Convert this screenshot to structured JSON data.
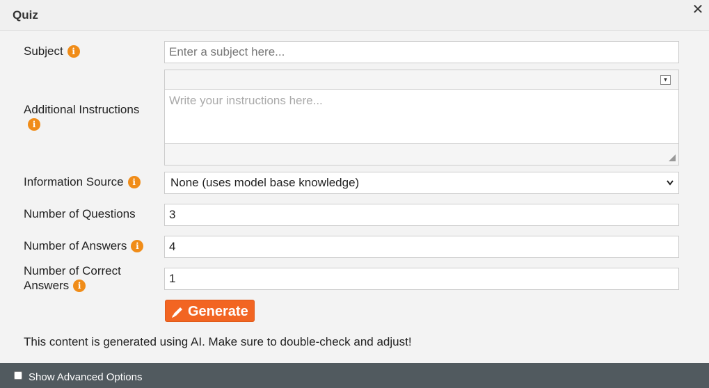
{
  "dialog": {
    "title": "Quiz",
    "close_glyph": "✕"
  },
  "form": {
    "subject": {
      "label": "Subject",
      "placeholder": "Enter a subject here...",
      "value": ""
    },
    "instructions": {
      "label": "Additional Instructions",
      "placeholder": "Write your instructions here..."
    },
    "info_source": {
      "label": "Information Source",
      "selected": "None (uses model base knowledge)"
    },
    "num_questions": {
      "label": "Number of Questions",
      "value": "3"
    },
    "num_answers": {
      "label": "Number of Answers",
      "value": "4"
    },
    "num_correct": {
      "label_line1": "Number of Correct",
      "label_line2": "Answers",
      "value": "1"
    }
  },
  "generate_button": {
    "label": "Generate"
  },
  "notice": "This content is generated using AI. Make sure to double-check and adjust!",
  "footer": {
    "advanced_label": "Show Advanced Options",
    "checked": false
  },
  "icons": {
    "info": "info-icon",
    "close": "close-icon",
    "pencil": "pencil-icon",
    "dropdown": "chevron-down-icon"
  },
  "colors": {
    "accent": "#f26522",
    "info": "#f08c18",
    "footer_bg": "#515a5f"
  }
}
